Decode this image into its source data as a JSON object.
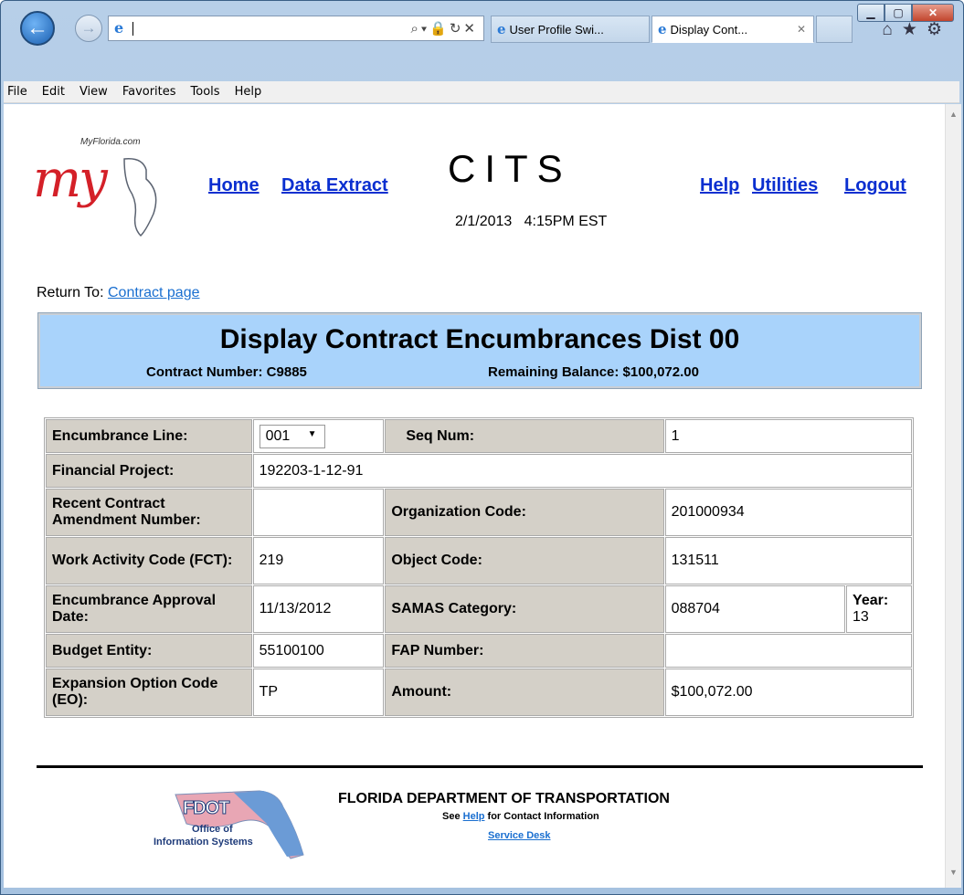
{
  "browser": {
    "tabs": [
      {
        "label": "User Profile Swi...",
        "active": false
      },
      {
        "label": "Display Cont...",
        "active": true
      }
    ],
    "menu": [
      "File",
      "Edit",
      "View",
      "Favorites",
      "Tools",
      "Help"
    ]
  },
  "header": {
    "logo_site": "MyFlorida.com",
    "logo_text": "my",
    "nav_left": [
      "Home",
      "Data Extract"
    ],
    "app_title": "CITS",
    "datetime": "2/1/2013   4:15PM EST",
    "nav_right": [
      "Help",
      "Utilities",
      "Logout"
    ]
  },
  "return_to": {
    "label": "Return To:",
    "link": "Contract page"
  },
  "banner": {
    "title": "Display Contract Encumbrances Dist 00",
    "contract_number": "Contract Number: C9885",
    "remaining_balance": "Remaining Balance: $100,072.00"
  },
  "form": {
    "encumbrance_line_label": "Encumbrance Line:",
    "encumbrance_line_value": "001",
    "seq_num_label": "Seq Num:",
    "seq_num_value": "1",
    "financial_project_label": "Financial Project:",
    "financial_project_value": "192203-1-12-91",
    "recent_amendment_label": "Recent Contract Amendment Number:",
    "recent_amendment_value": "",
    "organization_code_label": "Organization Code:",
    "organization_code_value": "201000934",
    "work_activity_label": "Work Activity Code (FCT):",
    "work_activity_value": "219",
    "object_code_label": "Object Code:",
    "object_code_value": "131511",
    "approval_date_label": "Encumbrance Approval Date:",
    "approval_date_value": "11/13/2012",
    "samas_label": "SAMAS Category:",
    "samas_value": "088704",
    "year_label": "Year:",
    "year_value": "13",
    "budget_entity_label": "Budget Entity:",
    "budget_entity_value": "55100100",
    "fap_label": "FAP Number:",
    "fap_value": "",
    "eo_label": "Expansion Option Code (EO):",
    "eo_value": "TP",
    "amount_label": "Amount:",
    "amount_value": "$100,072.00"
  },
  "footer": {
    "logo_main": "FDOT",
    "logo_sub1": "Office of",
    "logo_sub2": "Information Systems",
    "title": "FLORIDA DEPARTMENT OF TRANSPORTATION",
    "see": "See",
    "help_link": "Help",
    "see_rest": "for Contact Information",
    "service_desk": "Service Desk"
  }
}
